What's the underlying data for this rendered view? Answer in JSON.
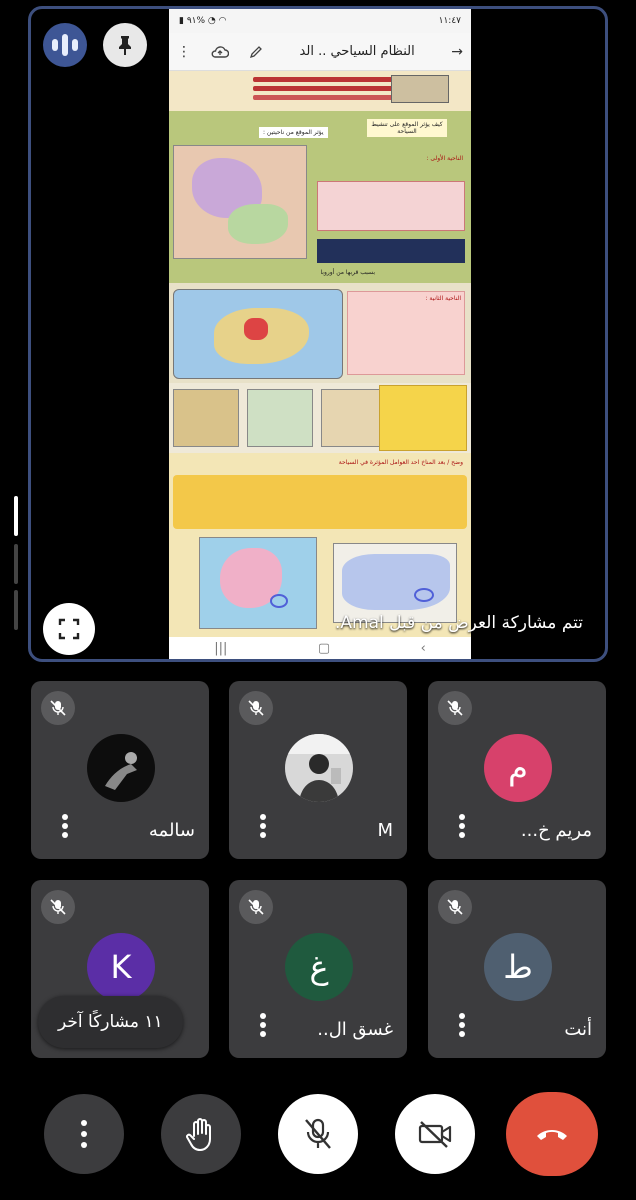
{
  "stage": {
    "share_caption": "تتم مشاركة العرض من قبل Amal.",
    "speaking_icon": "audio-level-icon",
    "pin_icon": "pin-icon",
    "fullscreen_icon": "fullscreen-icon",
    "border_color": "#3d4f7e"
  },
  "shared_screen": {
    "status_time": "١١:٤٧",
    "status_battery": "٩١%",
    "document_title": "النظام السياحي .. الد",
    "toolbar_icons": [
      "more-vert-icon",
      "cloud-upload-icon",
      "edit-pencil-icon",
      "back-arrow-icon"
    ],
    "doc_heading_1": "كيف يؤثر الموقع على تنشيط السياحة",
    "doc_heading_2": "يؤثر الموقع من ناحيتين :",
    "doc_heading_3": "الناحية الأولى :",
    "doc_heading_4": "الناحية الثانية :",
    "doc_heading_5": "وضح / بعد المناخ احد العوامل المؤثرة في السياحة",
    "doc_caption_1": "بسبب قربها من أوروبا"
  },
  "participants": [
    {
      "name": "سالمه",
      "avatar_type": "photo",
      "avatar_letter": "",
      "avatar_color": "#111111",
      "muted": true
    },
    {
      "name": "M",
      "avatar_type": "photo",
      "avatar_letter": "",
      "avatar_color": "#d8d8d8",
      "muted": true
    },
    {
      "name": "مريم خ...",
      "avatar_type": "letter",
      "avatar_letter": "م",
      "avatar_color": "#d7416b",
      "muted": true
    },
    {
      "name": "",
      "avatar_type": "letter",
      "avatar_letter": "K",
      "avatar_color": "#5b2ea6",
      "muted": true
    },
    {
      "name": "غسق ال..",
      "avatar_type": "letter",
      "avatar_letter": "غ",
      "avatar_color": "#1f5a3e",
      "muted": true
    },
    {
      "name": "أنت",
      "avatar_type": "letter",
      "avatar_letter": "ط",
      "avatar_color": "#4f5f70",
      "muted": true
    }
  ],
  "others_pill": "١١ مشاركًا آخر",
  "controls": {
    "more_icon": "more-vert-icon",
    "raise_hand_icon": "raise-hand-icon",
    "mic_icon": "mic-off-icon",
    "camera_icon": "camera-off-icon",
    "leave_icon": "call-end-icon",
    "leave_color": "#e0503c"
  }
}
